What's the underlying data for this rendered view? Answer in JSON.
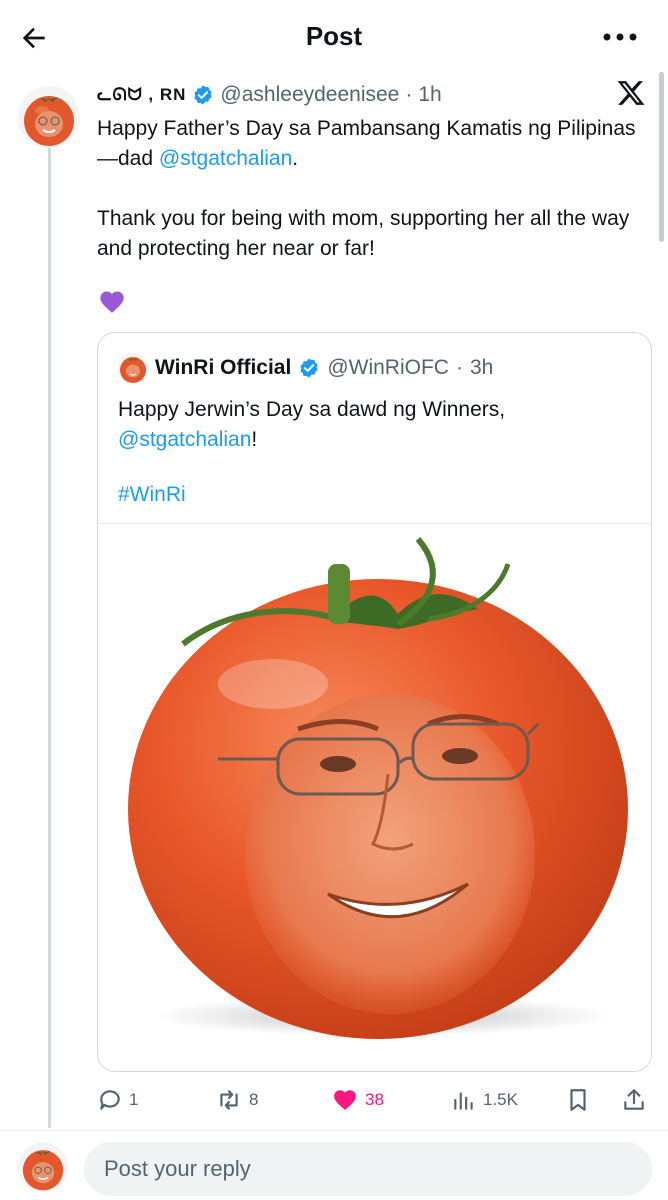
{
  "header": {
    "title": "Post",
    "back_icon": "arrow-left-icon",
    "more_icon": "more-horizontal-icon"
  },
  "tweet": {
    "display_name": "ᓚᘏᗢ , RN",
    "handle": "@ashleeydeenisee",
    "separator": "·",
    "time": "1h",
    "line1": "Happy Father’s Day sa Pambansang Kamatis ng Pilipinas—dad ",
    "mention": "@stgatchalian",
    "line1_end": ".",
    "line2": "Thank you for being with mom, supporting her all the way and protecting her near or far!",
    "emoji": "purple-heart-icon"
  },
  "quote": {
    "display_name": "WinRi Official",
    "handle": "@WinRiOFC",
    "separator": "·",
    "time": "3h",
    "text": "Happy Jerwin’s Day sa dawd ng Winners, ",
    "mention": "@stgatchalian",
    "text_end": "!",
    "hashtag": "#WinRi"
  },
  "actions": {
    "replies": "1",
    "reposts": "8",
    "likes": "38",
    "views": "1.5K"
  },
  "reply": {
    "placeholder": "Post your reply"
  },
  "colors": {
    "accent": "#1d9bf0",
    "like": "#f91880",
    "muted": "#536471",
    "tomato": "#e2572b"
  }
}
